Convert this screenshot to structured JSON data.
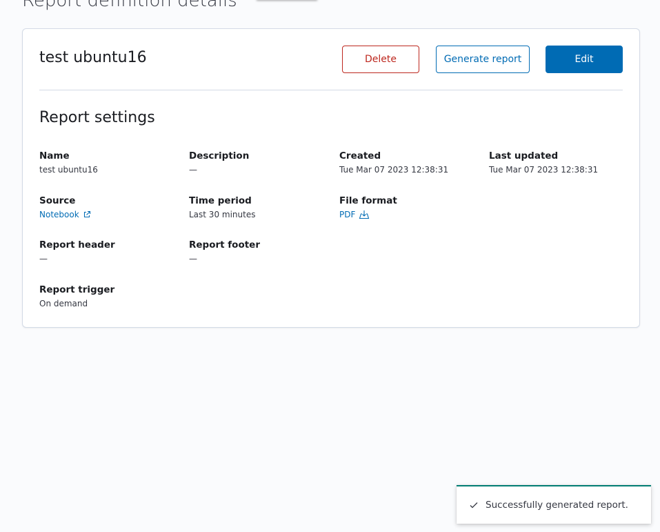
{
  "page": {
    "title": "Report definition details"
  },
  "report": {
    "name": "test ubuntu16"
  },
  "actions": {
    "delete_label": "Delete",
    "generate_label": "Generate report",
    "edit_label": "Edit"
  },
  "settings": {
    "section_title": "Report settings",
    "name": {
      "label": "Name",
      "value": "test ubuntu16"
    },
    "description": {
      "label": "Description",
      "value": "—"
    },
    "created": {
      "label": "Created",
      "value": "Tue Mar 07 2023 12:38:31"
    },
    "last_updated": {
      "label": "Last updated",
      "value": "Tue Mar 07 2023 12:38:31"
    },
    "source": {
      "label": "Source",
      "value": "Notebook",
      "icon": "external-link-icon"
    },
    "time_period": {
      "label": "Time period",
      "value": "Last 30 minutes"
    },
    "file_format": {
      "label": "File format",
      "value": "PDF",
      "icon": "download-icon"
    },
    "report_header": {
      "label": "Report header",
      "value": "—"
    },
    "report_footer": {
      "label": "Report footer",
      "value": "—"
    },
    "report_trigger": {
      "label": "Report trigger",
      "value": "On demand"
    }
  },
  "toast": {
    "message": "Successfully generated report.",
    "icon": "check-icon",
    "accent_color": "#017d73"
  },
  "colors": {
    "primary": "#006bb4",
    "danger": "#bd271e",
    "success": "#017d73"
  }
}
